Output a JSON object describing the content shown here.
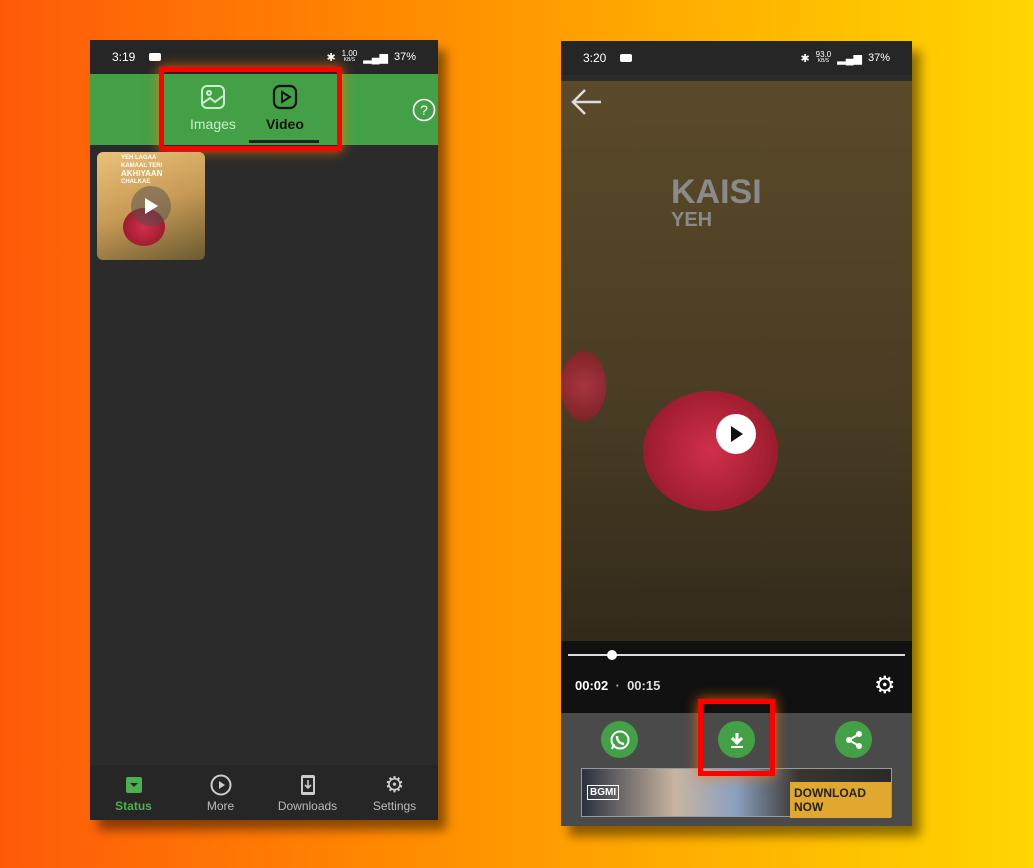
{
  "left_phone": {
    "status_bar": {
      "time": "3:19",
      "net_speed": "1.00",
      "net_unit": "KB/S",
      "battery": "37%"
    },
    "tabs": [
      {
        "label": "Images",
        "icon": "image-icon",
        "active": false
      },
      {
        "label": "Video",
        "icon": "play-square-icon",
        "active": true
      }
    ],
    "help_icon": "help-circle-icon",
    "thumbnail": {
      "text_lines": [
        "YEH LAGAA",
        "KAMAAL TERI",
        "AKHIYAAN",
        "CHALKAE"
      ]
    },
    "bottom_nav": [
      {
        "label": "Status",
        "icon": "status-icon",
        "active": true
      },
      {
        "label": "More",
        "icon": "play-circle-icon"
      },
      {
        "label": "Downloads",
        "icon": "download-phone-icon"
      },
      {
        "label": "Settings",
        "icon": "gear-icon"
      }
    ]
  },
  "right_phone": {
    "status_bar": {
      "time": "3:20",
      "net_speed": "93.0",
      "net_unit": "KB/S",
      "battery": "37%"
    },
    "video_text": {
      "line1": "KAISI",
      "line2": "YEH"
    },
    "player": {
      "current": "00:02",
      "separator": "·",
      "duration": "00:15",
      "progress": 0.13
    },
    "actions": [
      "whatsapp-icon",
      "download-icon",
      "share-icon"
    ],
    "ad": {
      "brand": "BGMI",
      "cta": "DOWNLOAD NOW"
    }
  },
  "colors": {
    "accent": "#43a047",
    "highlight": "#ff0000"
  }
}
